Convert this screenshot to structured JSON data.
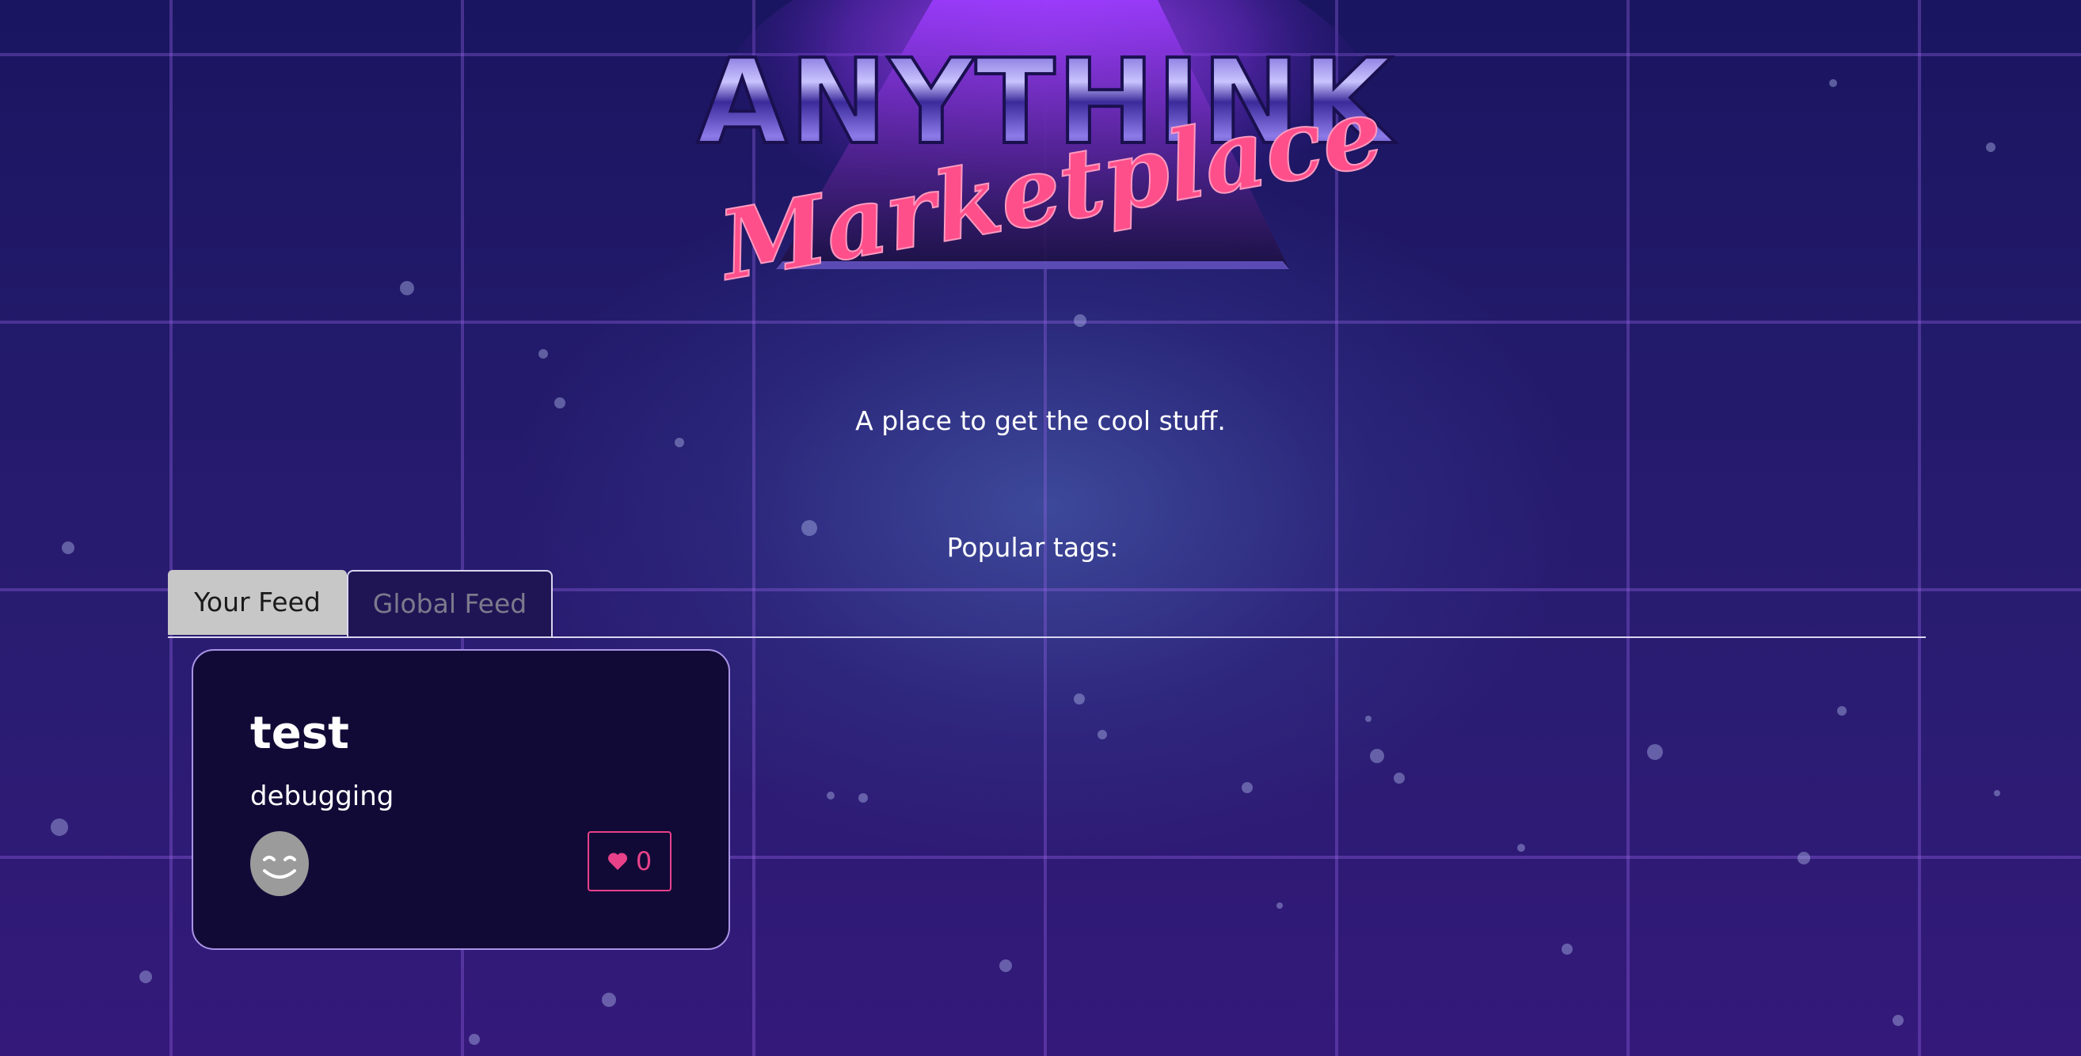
{
  "brand": {
    "logo_text": "ANYTHINK",
    "logo_script": "Marketplace"
  },
  "banner": {
    "tagline": "A place to get the cool stuff."
  },
  "tags": {
    "heading": "Popular tags:"
  },
  "feed_tabs": {
    "your_feed": "Your Feed",
    "global_feed": "Global Feed",
    "active": "Global Feed"
  },
  "items": [
    {
      "title": "test",
      "description": "debugging",
      "favorites_count": "0",
      "avatar_icon": "smiley-face-icon",
      "favorite_icon": "heart-icon"
    }
  ],
  "colors": {
    "accent_pink": "#e8418a",
    "card_bg": "#120a36",
    "card_border": "#a994e6",
    "tab_inactive_bg": "#c7c7c7"
  }
}
